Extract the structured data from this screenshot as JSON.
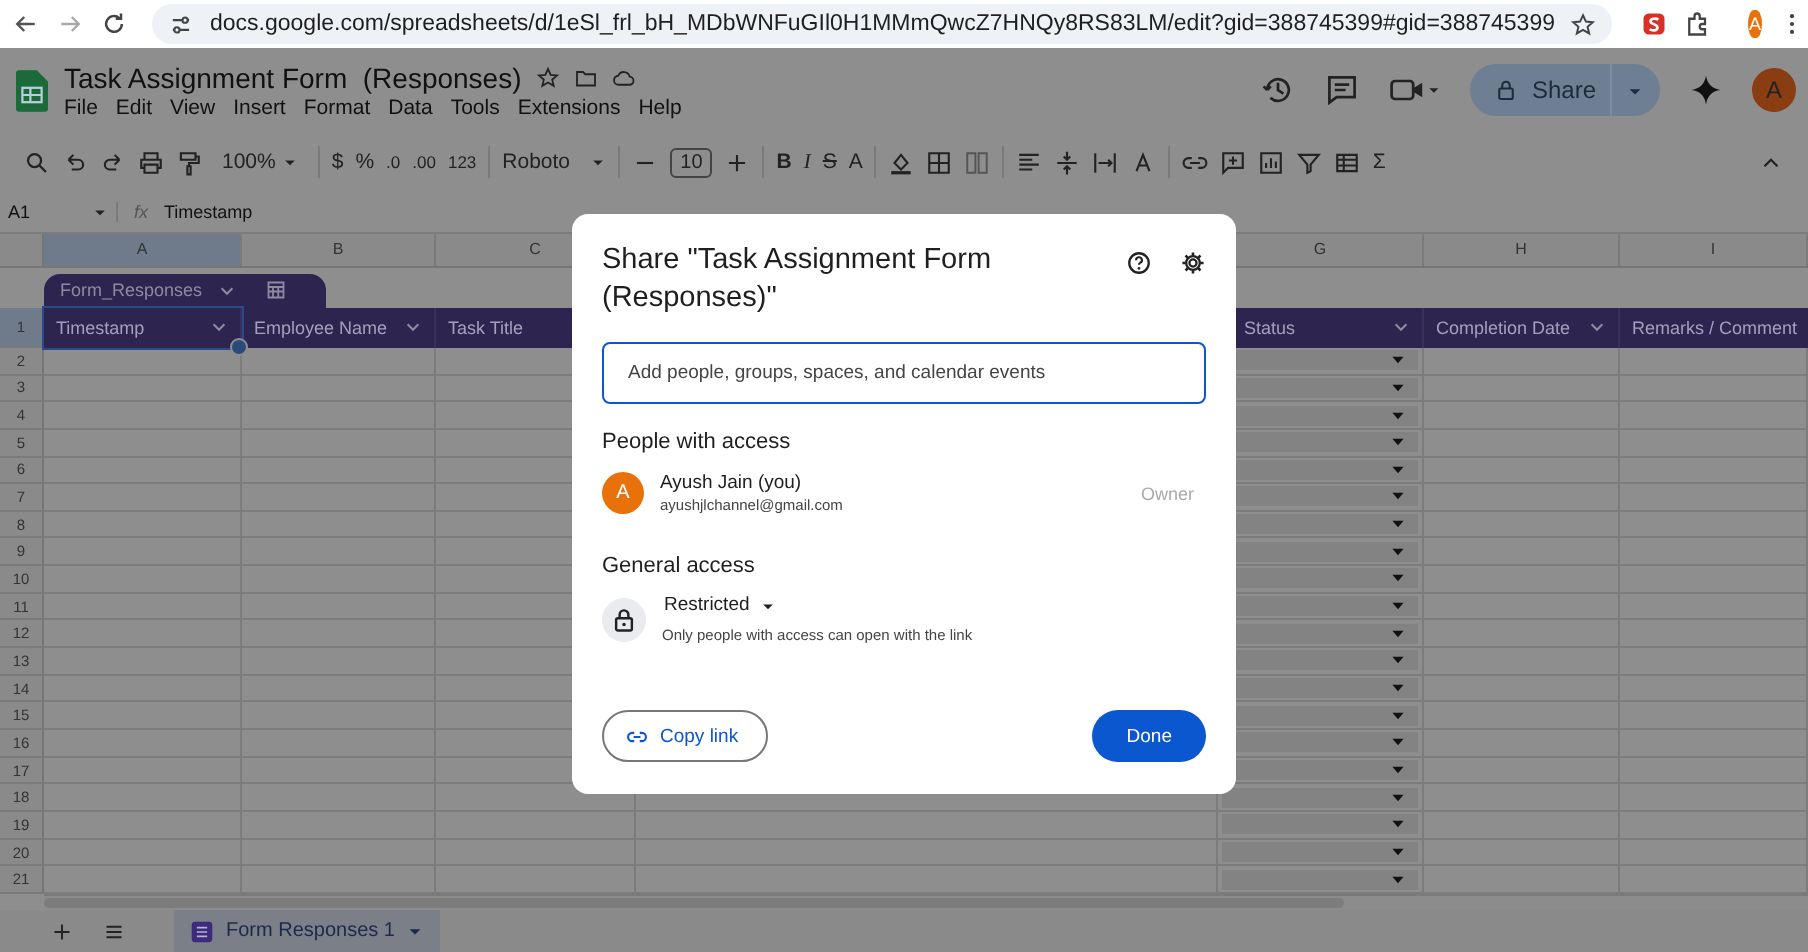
{
  "browser": {
    "url": "docs.google.com/spreadsheets/d/1eSl_frl_bH_MDbWNFuGIl0H1MMmQwcZ7HNQy8RS83LM/edit?gid=388745399#gid=388745399",
    "profile_initial": "A"
  },
  "document": {
    "title": "Task Assignment Form  (Responses)",
    "share_label": "Share",
    "user_initial": "A"
  },
  "menu": [
    "File",
    "Edit",
    "View",
    "Insert",
    "Format",
    "Data",
    "Tools",
    "Extensions",
    "Help"
  ],
  "toolbar": {
    "zoom": "100%",
    "currency": "$",
    "percent": "%",
    "decrease_decimals": ".0",
    "increase_decimals": ".00",
    "number_format": "123",
    "font": "Roboto",
    "font_size": "10",
    "bold": "B",
    "italic": "I",
    "strikethrough": "S",
    "text_color": "A",
    "sum": "Σ"
  },
  "formula_bar": {
    "cell": "A1",
    "fx": "fx",
    "content": "Timestamp"
  },
  "table_name": "Form_Responses",
  "columns": [
    {
      "letter": "A",
      "header": "Timestamp",
      "selected": true,
      "dropdown_cells": false
    },
    {
      "letter": "B",
      "header": "Employee Name",
      "selected": false,
      "dropdown_cells": false
    },
    {
      "letter": "C",
      "header": "Task Title",
      "selected": false,
      "dropdown_cells": false
    },
    {
      "letter": "G",
      "header": "Status",
      "selected": false,
      "dropdown_cells": true
    },
    {
      "letter": "H",
      "header": "Completion Date",
      "selected": false,
      "dropdown_cells": false
    },
    {
      "letter": "I",
      "header": "Remarks / Comment",
      "selected": false,
      "dropdown_cells": false
    }
  ],
  "row_numbers": [
    {
      "label": "1",
      "selected": true
    },
    {
      "label": "2",
      "selected": false
    },
    {
      "label": "3",
      "selected": false
    },
    {
      "label": "4",
      "selected": false
    },
    {
      "label": "5",
      "selected": false
    },
    {
      "label": "6",
      "selected": false
    },
    {
      "label": "7",
      "selected": false
    },
    {
      "label": "8",
      "selected": false
    },
    {
      "label": "9",
      "selected": false
    },
    {
      "label": "10",
      "selected": false
    },
    {
      "label": "11",
      "selected": false
    },
    {
      "label": "12",
      "selected": false
    },
    {
      "label": "13",
      "selected": false
    },
    {
      "label": "14",
      "selected": false
    },
    {
      "label": "15",
      "selected": false
    },
    {
      "label": "16",
      "selected": false
    },
    {
      "label": "17",
      "selected": false
    },
    {
      "label": "18",
      "selected": false
    },
    {
      "label": "19",
      "selected": false
    },
    {
      "label": "20",
      "selected": false
    },
    {
      "label": "21",
      "selected": false
    }
  ],
  "sheet_tabs": [
    {
      "label": "Form Responses 1",
      "selected": true
    }
  ],
  "dialog": {
    "title": "Share \"Task Assignment Form (Responses)\"",
    "placeholder": "Add people, groups, spaces, and calendar events",
    "people_heading": "People with access",
    "people": [
      {
        "initial": "A",
        "name": "Ayush Jain (you)",
        "email": "ayushjlchannel@gmail.com",
        "role": "Owner",
        "color": "#e8710a"
      }
    ],
    "general_heading": "General access",
    "access_level": "Restricted",
    "access_description": "Only people with access can open with the link",
    "copy_label": "Copy link",
    "done_label": "Done"
  }
}
